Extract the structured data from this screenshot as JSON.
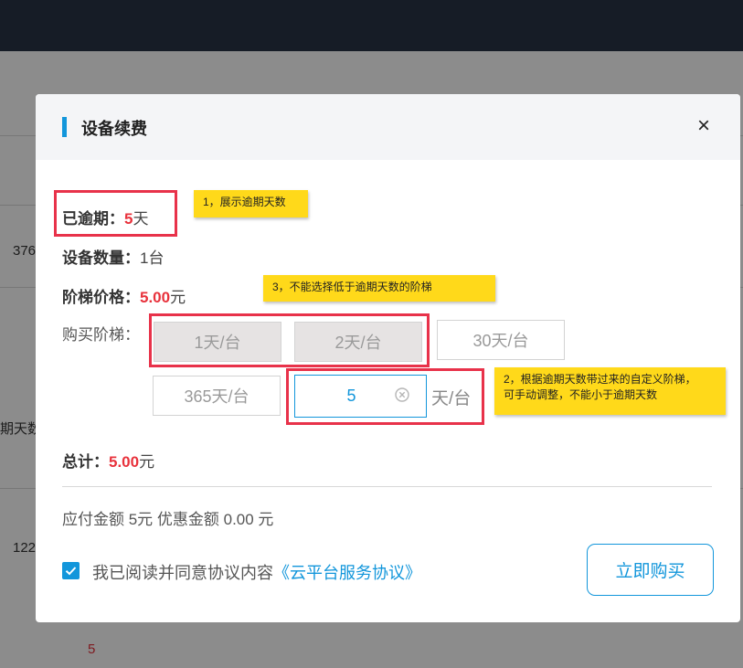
{
  "background": {
    "snippets": [
      "376",
      "期天数",
      "122",
      "5"
    ]
  },
  "dialog": {
    "title": "设备续费",
    "close_icon": "close-icon",
    "overdue": {
      "label": "已逾期：",
      "value": "5",
      "unit": "天"
    },
    "quantity": {
      "label": "设备数量：",
      "value": "1台"
    },
    "tier_price": {
      "label": "阶梯价格：",
      "value": "5.00",
      "unit": "元"
    },
    "tiers": {
      "label": "购买阶梯：",
      "options": [
        {
          "label": "1天/台",
          "state": "disabled"
        },
        {
          "label": "2天/台",
          "state": "disabled"
        },
        {
          "label": "30天/台",
          "state": "enabled"
        },
        {
          "label": "365天/台",
          "state": "enabled"
        }
      ],
      "custom_value": "5",
      "custom_unit": "天/台"
    },
    "total": {
      "label": "总计：",
      "value": "5.00",
      "unit": "元"
    },
    "payment_summary": "应付金额 5元 优惠金额 0.00 元",
    "agreement": {
      "checked": true,
      "text": "我已阅读并同意协议内容",
      "link": "《云平台服务协议》"
    },
    "buy_button": "立即购买"
  },
  "annotations": [
    {
      "text": "1，展示逾期天数"
    },
    {
      "text": "3，不能选择低于逾期天数的阶梯"
    },
    {
      "lines": [
        "2，根据逾期天数带过来的自定义阶梯，",
        "可手动调整，不能小于逾期天数"
      ]
    }
  ],
  "colors": {
    "accent": "#1296db",
    "danger": "#e8323c",
    "note": "#ffd91a",
    "topbar": "#161c26"
  }
}
